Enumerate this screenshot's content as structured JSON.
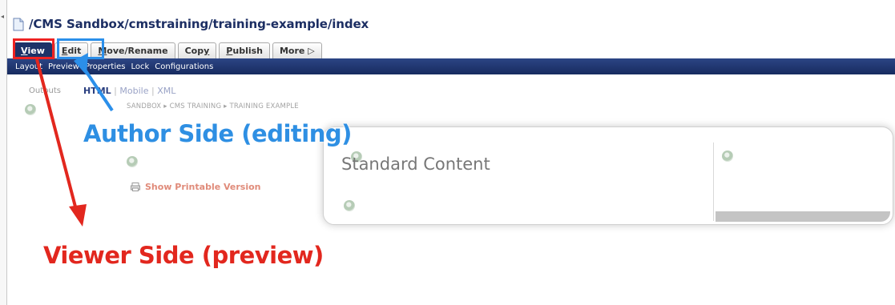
{
  "path": "/CMS Sandbox/cmstraining/training-example/index",
  "tabs": {
    "view": {
      "label_u": "V",
      "label_rest": "iew"
    },
    "edit": {
      "label_u": "E",
      "label_rest": "dit"
    },
    "move": {
      "label_u": "M",
      "label_rest": "ove/Rename"
    },
    "copy": {
      "label_rest": "Cop",
      "label_u": "y"
    },
    "publish": {
      "label_u": "P",
      "label_rest": "ublish"
    },
    "more": {
      "label": "More ▷"
    }
  },
  "subnav": [
    "Layout",
    "Preview",
    "Properties",
    "Lock",
    "Configurations"
  ],
  "outputs": {
    "label": "Outputs",
    "current": "HTML",
    "others": [
      "Mobile",
      "XML"
    ],
    "separator": "|"
  },
  "breadcrumb": "SANDBOX ▸ CMS TRAINING ▸ TRAINING EXAMPLE",
  "print_link": "Show Printable Version",
  "standard_content": "Standard Content",
  "annotations": {
    "author": "Author Side (editing)",
    "viewer": "Viewer Side (preview)"
  },
  "colors": {
    "nav_bar": "#1d3268",
    "author_callout": "#2e8fe3",
    "viewer_callout": "#e2271e",
    "path": "#1c2e63"
  },
  "icons": {
    "page": "page-icon",
    "print": "print-icon",
    "gear": "gear-icon"
  }
}
